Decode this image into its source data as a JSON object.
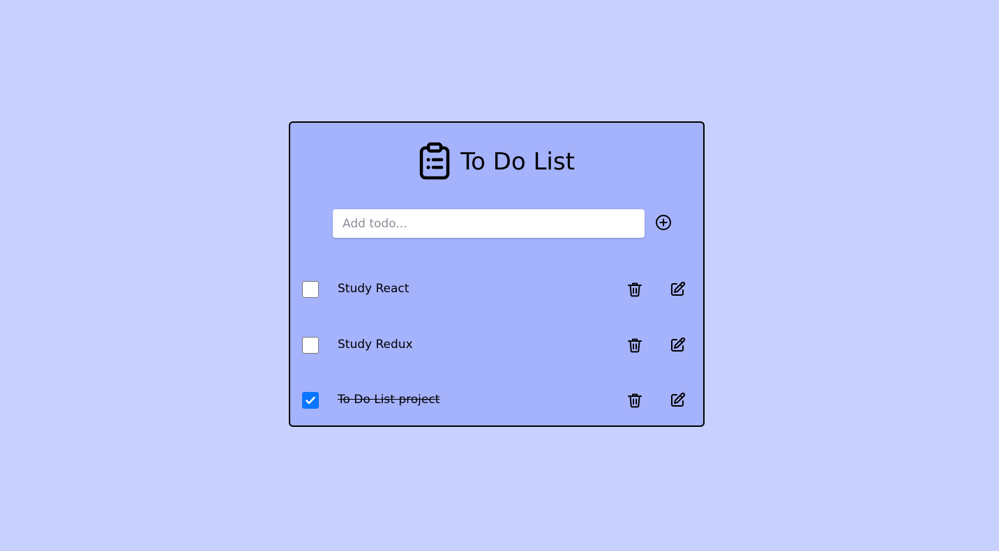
{
  "app": {
    "title": "To Do List",
    "title_icon": "clipboard-list-icon"
  },
  "input": {
    "value": "",
    "placeholder": "Add todo...",
    "add_icon": "plus-circle-icon"
  },
  "todos": [
    {
      "text": "Study React",
      "completed": false
    },
    {
      "text": "Study Redux",
      "completed": false
    },
    {
      "text": "To Do List project",
      "completed": true
    }
  ],
  "item_icons": {
    "delete": "trash-icon",
    "edit": "edit-icon"
  },
  "colors": {
    "page_background": "#c7d0ff",
    "card_background": "#a5b2fc",
    "checkbox_checked": "#0a75ff"
  }
}
